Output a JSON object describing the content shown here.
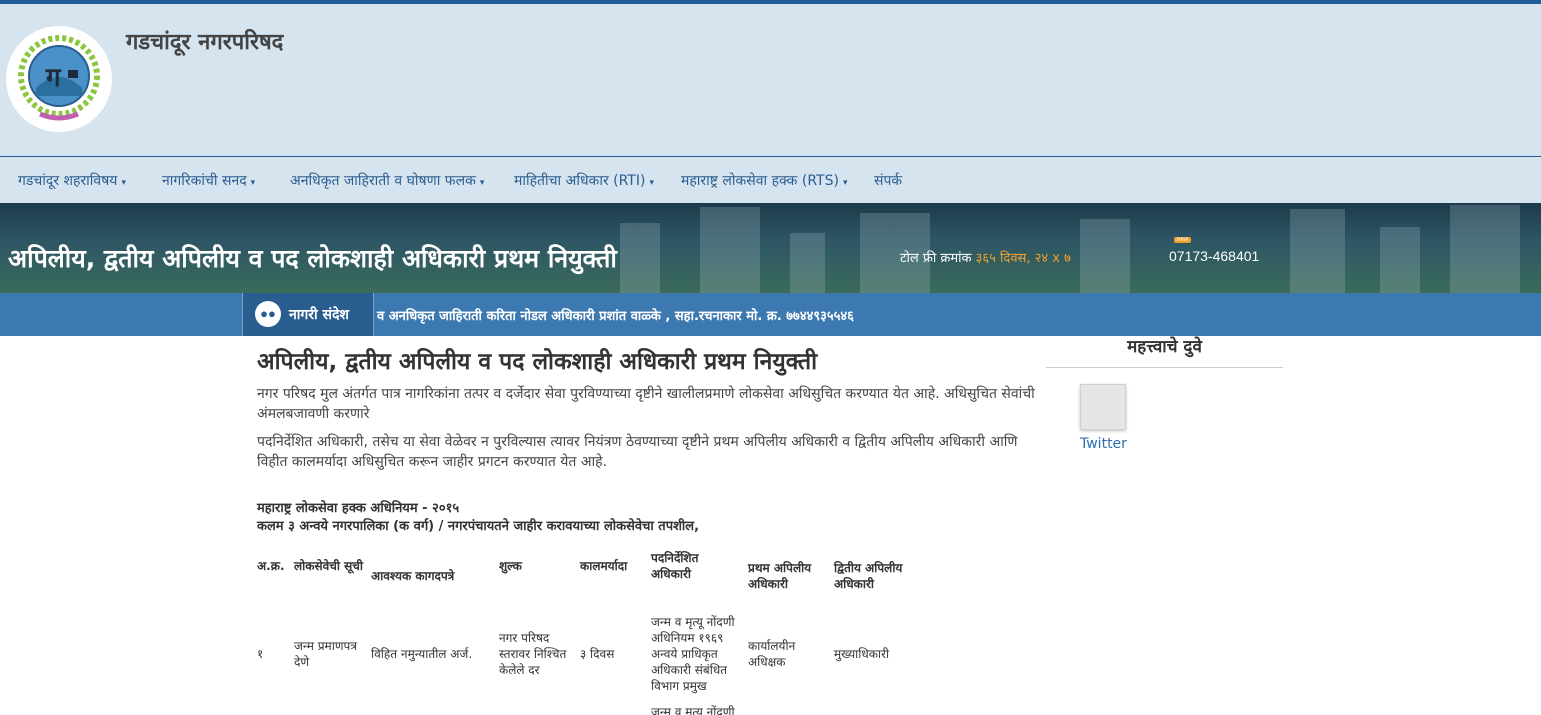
{
  "header": {
    "site_title": "गडचांदूर नगरपरिषद"
  },
  "nav": {
    "items": [
      {
        "label": "गडचांदूर शहराविषय",
        "caret": "▾"
      },
      {
        "label": "नागरिकांची सनद",
        "caret": "▾"
      },
      {
        "label": "अनधिकृत जाहिराती व घोषणा फलक",
        "caret": "▾"
      },
      {
        "label": "माहितीचा अधिकार (RTI)",
        "caret": "▾"
      },
      {
        "label": "महाराष्ट्र लोकसेवा हक्क (RTS)",
        "caret": "▾"
      },
      {
        "label": "संपर्क",
        "caret": ""
      }
    ]
  },
  "banner": {
    "title": "अपिलीय, द्वतीय अपिलीय व पद लोकशाही अधिकारी प्रथम नियुक्ती",
    "tollfree_label": "टोल फ्री क्रमांक",
    "tollfree_hours": "३६५ दिवस, २४ x ७",
    "new_badge": "new",
    "phone": "07173-468401"
  },
  "news": {
    "label": "नागरी संदेश",
    "ticker": "व अनधिकृत जाहिराती करिता नोडल अधिकारी प्रशांत वाळ्के , सहा.रचनाकार मो. क्र. ७७४४९३५५४६"
  },
  "main": {
    "title": "अपिलीय, द्वतीय अपिलीय व पद लोकशाही अधिकारी प्रथम नियुक्ती",
    "para1": "नगर परिषद मुल अंतर्गत पात्र नागरिकांना तत्पर व दर्जेदार सेवा पुरविण्याच्या दृष्टीने खालीलप्रमाणे लोकसेवा अधिसुचित करण्यात येत आहे. अधिसुचित सेवांची अंमलबजावणी करणारे",
    "para2": "पदनिर्देशित अधिकारी, तसेच या सेवा वेळेवर न पुरविल्यास त्यावर नियंत्रण ठेवण्याच्या दृष्टीने प्रथम अपिलीय अधिकारी व द्वितीय अपिलीय अधिकारी आणि विहीत कालमर्यादा अधिसुचित करून जाहीर प्रगटन करण्यात येत आहे.",
    "act_title": "महाराष्ट्र लोकसेवा हक्क अधिनियम - २०१५",
    "act_subtitle": "कलम ३ अन्वये नगरपालिका (क वर्ग) / नगरपंचायतने जाहीर करावयाच्या लोकसेवेचा तपशील,"
  },
  "table": {
    "headers": {
      "sr": "अ.क्र.",
      "service": "लोकसेवेची सूची",
      "docs": "आवश्यक कागदपत्रे",
      "fee": "शुल्क",
      "time": "कालमर्यादा",
      "officer": "पदनिर्देशित अधिकारी",
      "first_appeal": "प्रथम अपिलीय अधिकारी",
      "second_appeal": "द्वितीय अपिलीय अधिकारी"
    },
    "rows": [
      {
        "sr": "१",
        "service": "जन्म प्रमाणपत्र देणे",
        "docs": "विहित नमुन्यातील अर्ज.",
        "fee": "नगर परिषद स्तरावर निश्चित केलेले दर",
        "time": "३ दिवस",
        "officer": "जन्म व मृत्यू नोंदणी अधिनियम १९६९ अन्वये प्राधिकृत अधिकारी संबंधित विभाग प्रमुख",
        "first_appeal": "कार्यालयीन अधिक्षक",
        "second_appeal": "मुख्याधिकारी"
      }
    ],
    "next_row_partial": "जन्म व मृत्यू नोंदणी"
  },
  "sidebar": {
    "title": "महत्त्वाचे दुवे",
    "twitter_label": "Twitter"
  },
  "colors": {
    "header_bg": "#d6e4f0",
    "nav_text": "#2a5d8f",
    "newsbar_bg": "#3d79b1",
    "accent_orange": "#f0a030",
    "link_blue": "#2a6fb3"
  }
}
